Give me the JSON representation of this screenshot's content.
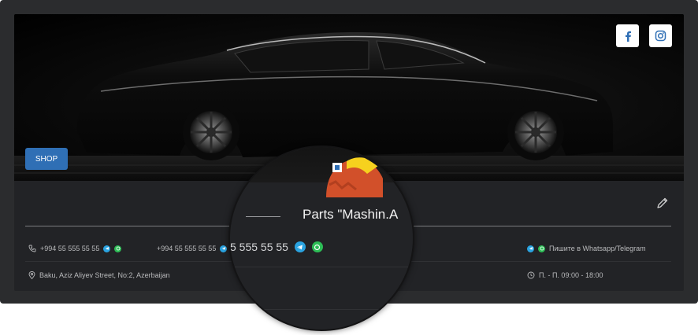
{
  "social": {
    "facebook_icon": "facebook-icon",
    "instagram_icon": "instagram-icon"
  },
  "cover": {
    "shop_label": "SHOP",
    "image": "black sedan side view"
  },
  "store": {
    "name": "Parts \"Mashin.A"
  },
  "contacts": {
    "phone1": "+994 55 555 55 55",
    "phone2": "+994 55 555 55 55",
    "phone_zoomed": "5 555 55 55",
    "messenger_note": "Пишите в Whatsapp/Telegram",
    "address": "Baku, Aziz Aliyev Street, No:2, Azerbaijan",
    "hours": "П. - П. 09:00 - 18:00"
  },
  "colors": {
    "accent": "#2f6fb5",
    "telegram": "#2aa3e0",
    "whatsapp": "#2dbd56",
    "card_bg": "#222326"
  }
}
